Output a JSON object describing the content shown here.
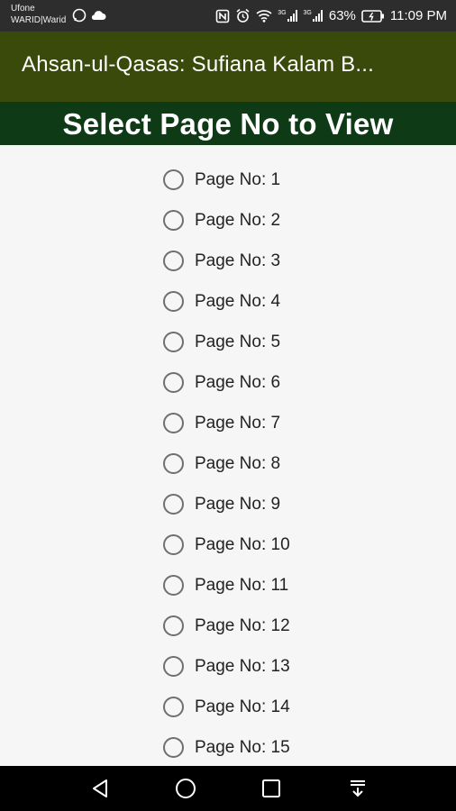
{
  "status_bar": {
    "carrier_line1": "Ufone",
    "carrier_line2": "WARID|Warid",
    "battery_percent": "63%",
    "time": "11:09 PM",
    "network_label_1": "3G",
    "network_label_2": "3G"
  },
  "app_bar": {
    "title": "Ahsan-ul-Qasas: Sufiana Kalam B..."
  },
  "header": {
    "title": "Select Page No to View"
  },
  "pages": [
    {
      "label": "Page No: 1",
      "selected": false
    },
    {
      "label": "Page No: 2",
      "selected": false
    },
    {
      "label": "Page No: 3",
      "selected": false
    },
    {
      "label": "Page No: 4",
      "selected": false
    },
    {
      "label": "Page No: 5",
      "selected": false
    },
    {
      "label": "Page No: 6",
      "selected": false
    },
    {
      "label": "Page No: 7",
      "selected": false
    },
    {
      "label": "Page No: 8",
      "selected": false
    },
    {
      "label": "Page No: 9",
      "selected": false
    },
    {
      "label": "Page No: 10",
      "selected": false
    },
    {
      "label": "Page No: 11",
      "selected": false
    },
    {
      "label": "Page No: 12",
      "selected": false
    },
    {
      "label": "Page No: 13",
      "selected": false
    },
    {
      "label": "Page No: 14",
      "selected": false
    },
    {
      "label": "Page No: 15",
      "selected": false
    }
  ],
  "nav_bar": {
    "icons": [
      "back-icon",
      "home-icon",
      "recents-icon",
      "notifications-down-icon"
    ]
  },
  "colors": {
    "app_bar": "#3a4a0b",
    "header": "#0f3a16",
    "background": "#f6f6f6"
  }
}
